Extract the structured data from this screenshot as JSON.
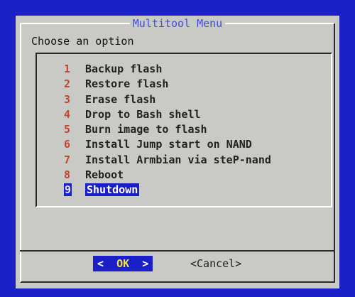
{
  "dialog": {
    "title": "Multitool Menu",
    "prompt": "Choose an option"
  },
  "menu": {
    "items": [
      {
        "tag": "1",
        "label": "Backup flash"
      },
      {
        "tag": "2",
        "label": "Restore flash"
      },
      {
        "tag": "3",
        "label": "Erase flash"
      },
      {
        "tag": "4",
        "label": "Drop to Bash shell"
      },
      {
        "tag": "5",
        "label": "Burn image to flash"
      },
      {
        "tag": "6",
        "label": "Install Jump start on NAND"
      },
      {
        "tag": "7",
        "label": "Install Armbian via steP-nand"
      },
      {
        "tag": "8",
        "label": "Reboot"
      },
      {
        "tag": "9",
        "label": "Shutdown",
        "selected": true
      }
    ]
  },
  "buttons": {
    "ok_left": "<",
    "ok_label": "OK",
    "ok_right": ">",
    "cancel_label": "<Cancel>"
  },
  "colors": {
    "screen_background": "#1b1fc8",
    "dialog_background": "#c9c9c6",
    "title_text": "#3f4fd6",
    "tag_text": "#c7442c",
    "selection_background": "#1b1fc8",
    "selection_text": "#ffffff"
  }
}
